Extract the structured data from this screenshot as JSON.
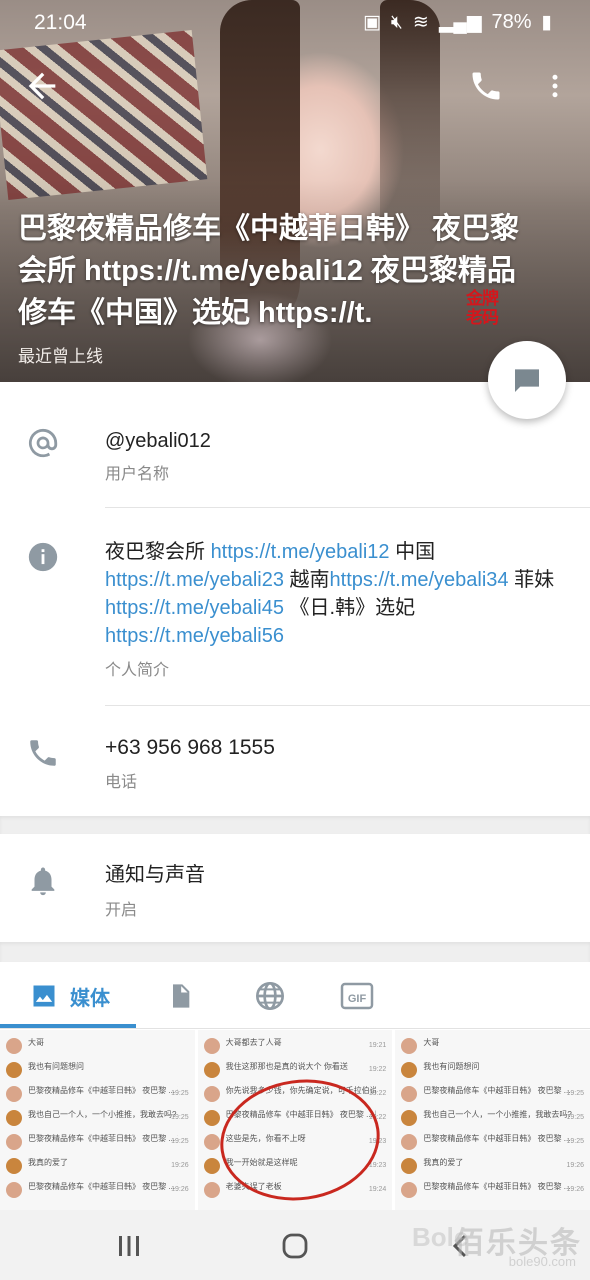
{
  "status_bar": {
    "time": "21:04",
    "battery": "78%"
  },
  "profile": {
    "name": "巴黎夜精品修车《中越菲日韩》 夜巴黎会所 https://t.me/yebali12 夜巴黎精品修车《中国》选妃 https://t.",
    "seal_text": "金牌老码",
    "last_seen": "最近曾上线"
  },
  "info": {
    "username": {
      "value": "@yebali012",
      "label": "用户名称"
    },
    "bio": {
      "label": "个人简介",
      "segments": [
        {
          "text": "夜巴黎会所 ",
          "link": false
        },
        {
          "text": "https://t.me/yebali12",
          "link": true
        },
        {
          "text": " 中国 ",
          "link": false
        },
        {
          "text": "https://t.me/yebali23",
          "link": true
        },
        {
          "text": " 越南",
          "link": false
        },
        {
          "text": "https://t.me/yebali34",
          "link": true
        },
        {
          "text": " 菲妹 ",
          "link": false
        },
        {
          "text": "https://t.me/yebali45",
          "link": true
        },
        {
          "text": " 《日.韩》选妃 ",
          "link": false
        },
        {
          "text": "https://t.me/yebali56",
          "link": true
        }
      ]
    },
    "phone": {
      "value": "+63 956 968 1555",
      "label": "电话"
    },
    "notifications": {
      "title": "通知与声音",
      "state": "开启"
    }
  },
  "tabs": {
    "media_label": "媒体",
    "active": "media",
    "icons": [
      "image-icon",
      "file-icon",
      "globe-icon",
      "gif-icon"
    ]
  },
  "media_thumbs": [
    {
      "lines": [
        {
          "text": "大哥",
          "time": ""
        },
        {
          "text": "我也有问题想问",
          "time": ""
        },
        {
          "text": "巴黎夜精品修车《中越菲日韩》 夜巴黎 ... 这么说老板，现在所有的规矩基本上事没有数去你们的",
          "time": "19:25"
        },
        {
          "text": "我也自己一个人，一个小推推，我敢去吗?",
          "time": "19:25"
        },
        {
          "text": "巴黎夜精品修车《中越菲日韩》 夜巴黎 ... 有，没有这样老板",
          "time": "19:25"
        },
        {
          "text": "我真的爱了",
          "time": "19:26"
        },
        {
          "text": "巴黎夜精品修车《中越菲日韩》 夜巴黎 ... 不行就去广东还是啊",
          "time": "19:26"
        }
      ]
    },
    {
      "lines": [
        {
          "text": "大哥都去了人哥",
          "time": "19:21"
        },
        {
          "text": "我住这那那也是真的说大个 你看送",
          "time": "19:22"
        },
        {
          "text": "你先说我多少钱，你先确定说，可千拉伯说",
          "time": "19:22"
        },
        {
          "text": "巴黎夜精品修车《中越菲日韩》 夜巴黎 ... 图片",
          "time": "19:22"
        },
        {
          "text": "这些是先，你看不上呀",
          "time": "19:23"
        },
        {
          "text": "我一开始就是这样呢",
          "time": "19:23"
        },
        {
          "text": "老婆失误了老板",
          "time": "19:24"
        }
      ]
    },
    {
      "lines": [
        {
          "text": "大哥",
          "time": ""
        },
        {
          "text": "我也有问题想问",
          "time": ""
        },
        {
          "text": "巴黎夜精品修车《中越菲日韩》 夜巴黎 ... 这么说老板，现在所有的规矩基本上事没有数去你们的",
          "time": "19:25"
        },
        {
          "text": "我也自己一个人，一个小推推，我敢去吗?",
          "time": "19:25"
        },
        {
          "text": "巴黎夜精品修车《中越菲日韩》 夜巴黎 ... 有，没有这样老板",
          "time": "19:25"
        },
        {
          "text": "我真的爱了",
          "time": "19:26"
        },
        {
          "text": "巴黎夜精品修车《中越菲日韩》 夜巴黎 ... 不行就去广东还是啊",
          "time": "19:26"
        }
      ]
    }
  ],
  "watermark": {
    "main": "佰乐头条",
    "sub": "bole90.com",
    "left": "Bole"
  },
  "colors": {
    "accent": "#3a8fcf",
    "icon_gray": "#8f9aa3",
    "annotation_red": "#c9281f"
  }
}
